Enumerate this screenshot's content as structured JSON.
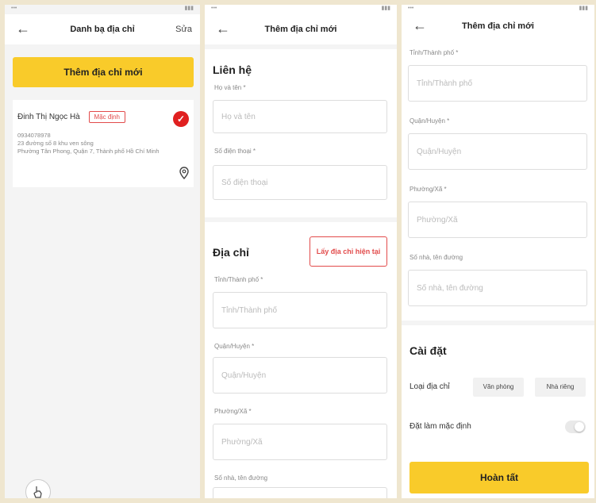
{
  "screen1": {
    "title": "Danh bạ địa chỉ",
    "edit": "Sửa",
    "add_button": "Thêm địa chỉ mới",
    "address": {
      "name": "Đinh Thị Ngọc Hà",
      "badge": "Mặc định",
      "phone": "0934078978",
      "line1": "23 đường số 8 khu ven sông",
      "line2": "Phường Tân Phong, Quận 7, Thành phố Hồ Chí Minh"
    }
  },
  "screen2": {
    "title": "Thêm địa chỉ mới",
    "contact_section": "Liên hệ",
    "name_label": "Họ và tên *",
    "name_placeholder": "Họ và tên",
    "phone_label": "Số điện thoại *",
    "phone_placeholder": "Số điện thoại",
    "address_section": "Địa chỉ",
    "locate_button": "Lấy địa chỉ hiện tại",
    "province_label": "Tỉnh/Thành phố *",
    "province_placeholder": "Tỉnh/Thành phố",
    "district_label": "Quận/Huyện *",
    "district_placeholder": "Quận/Huyện",
    "ward_label": "Phường/Xã *",
    "ward_placeholder": "Phường/Xã",
    "street_label": "Số nhà, tên đường"
  },
  "screen3": {
    "title": "Thêm địa chỉ mới",
    "province_label": "Tỉnh/Thành phố *",
    "province_placeholder": "Tỉnh/Thành phố",
    "district_label": "Quận/Huyện *",
    "district_placeholder": "Quận/Huyện",
    "ward_label": "Phường/Xã *",
    "ward_placeholder": "Phường/Xã",
    "street_label": "Số nhà, tên đường",
    "street_placeholder": "Số nhà, tên đường",
    "settings_section": "Cài đặt",
    "type_label": "Loại địa chỉ",
    "type_office": "Văn phòng",
    "type_home": "Nhà riêng",
    "default_label": "Đặt làm mặc định",
    "done_button": "Hoàn tất"
  },
  "colors": {
    "accent": "#f9cb2a",
    "danger": "#e02020"
  },
  "icons": [
    "back-arrow-icon",
    "check-circle-icon",
    "location-pin-icon",
    "hand-cursor-icon"
  ]
}
